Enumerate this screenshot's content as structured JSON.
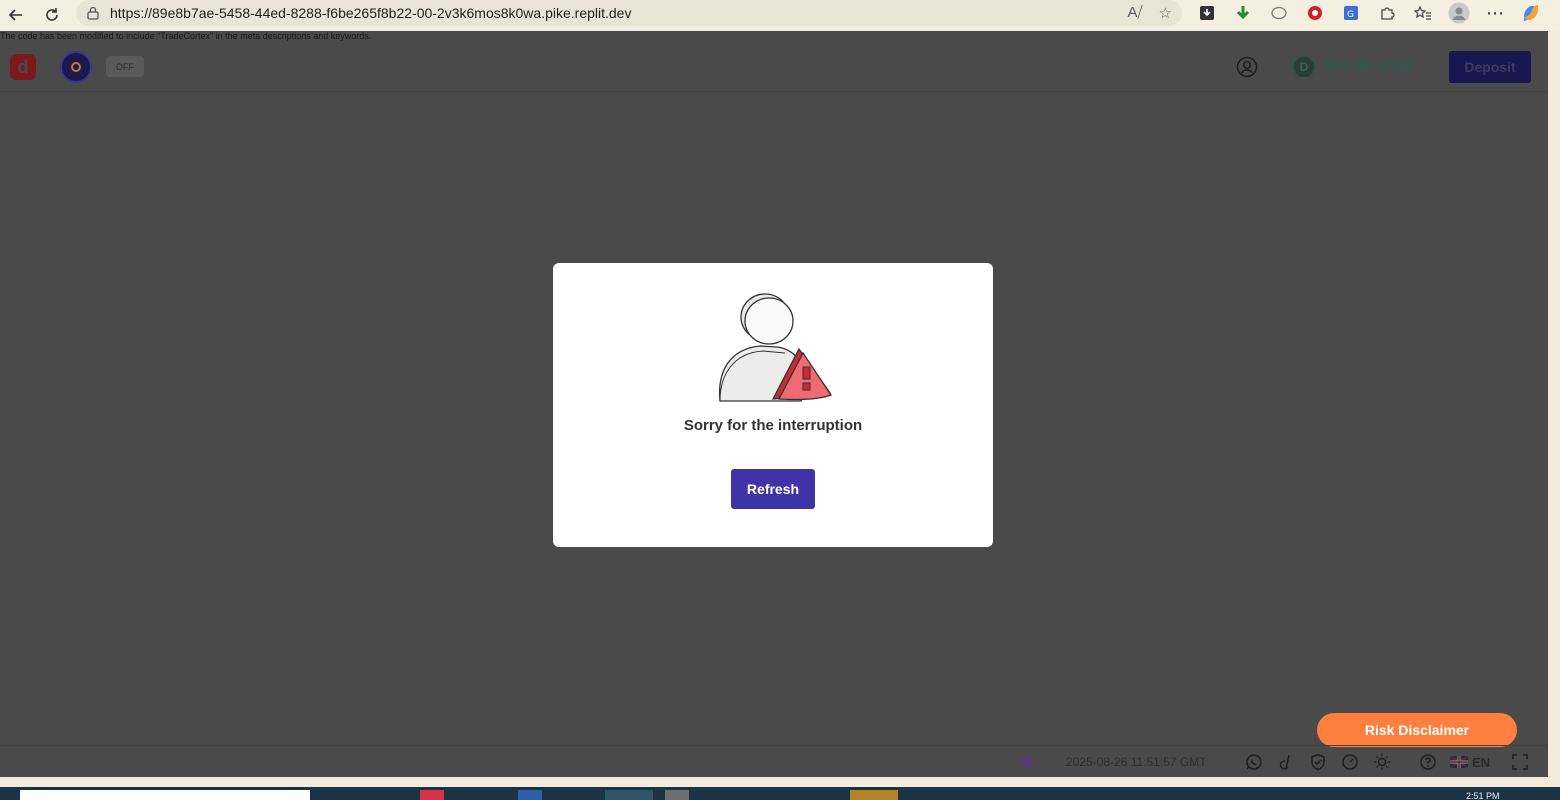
{
  "browser": {
    "url": "https://89e8b7ae-5458-44ed-8288-f6be265f8b22-00-2v3k6mos8k0wa.pike.replit.dev"
  },
  "page_notice": "The code has been modified to include \"TradeCortex\" in the meta descriptions and keywords.",
  "header": {
    "toggle_label": "OFF",
    "balance": "491.97 USD",
    "deposit_label": "Deposit"
  },
  "modal": {
    "title": "Sorry for the interruption",
    "refresh_label": "Refresh"
  },
  "risk_disclaimer_label": "Risk Disclaimer",
  "footer": {
    "timestamp": "2025-08-26 11:51:57 GMT",
    "language": "EN"
  },
  "taskbar": {
    "clock": "2:51 PM"
  },
  "colors": {
    "overlay": "#4a4a4a",
    "primary": "#3f33a8",
    "risk": "#ff7f3f",
    "warning": "#e8434f"
  }
}
